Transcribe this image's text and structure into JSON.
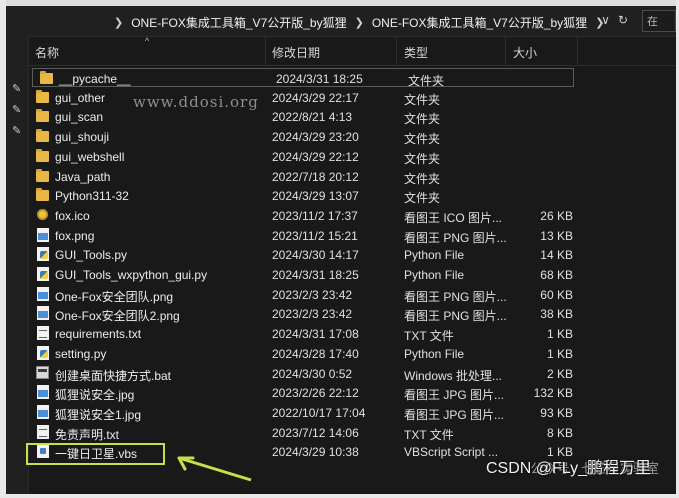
{
  "address": {
    "crumbs": [
      "ONE-FOX集成工具箱_V7公开版_by狐狸",
      "ONE-FOX集成工具箱_V7公开版_by狐狸"
    ],
    "search_placeholder": "在"
  },
  "headers": {
    "name": "名称",
    "date": "修改日期",
    "type": "类型",
    "size": "大小"
  },
  "files": [
    {
      "name": "__pycache__",
      "date": "2024/3/31 18:25",
      "type": "文件夹",
      "size": "",
      "icon": "folder-icon",
      "kind": "folder"
    },
    {
      "name": "gui_other",
      "date": "2024/3/29 22:17",
      "type": "文件夹",
      "size": "",
      "icon": "folder-icon",
      "kind": "folder"
    },
    {
      "name": "gui_scan",
      "date": "2022/8/21 4:13",
      "type": "文件夹",
      "size": "",
      "icon": "folder-icon",
      "kind": "folder"
    },
    {
      "name": "gui_shouji",
      "date": "2024/3/29 23:20",
      "type": "文件夹",
      "size": "",
      "icon": "folder-icon",
      "kind": "folder"
    },
    {
      "name": "gui_webshell",
      "date": "2024/3/29 22:12",
      "type": "文件夹",
      "size": "",
      "icon": "folder-icon",
      "kind": "folder"
    },
    {
      "name": "Java_path",
      "date": "2022/7/18 20:12",
      "type": "文件夹",
      "size": "",
      "icon": "folder-icon",
      "kind": "folder"
    },
    {
      "name": "Python311-32",
      "date": "2024/3/29 13:07",
      "type": "文件夹",
      "size": "",
      "icon": "folder-icon",
      "kind": "folder"
    },
    {
      "name": "fox.ico",
      "date": "2023/11/2 17:37",
      "type": "看图王 ICO 图片...",
      "size": "26 KB",
      "icon": "ico-file-icon",
      "kind": "ico"
    },
    {
      "name": "fox.png",
      "date": "2023/11/2 15:21",
      "type": "看图王 PNG 图片...",
      "size": "13 KB",
      "icon": "image-file-icon",
      "kind": "img"
    },
    {
      "name": "GUI_Tools.py",
      "date": "2024/3/30 14:17",
      "type": "Python File",
      "size": "14 KB",
      "icon": "python-file-icon",
      "kind": "py"
    },
    {
      "name": "GUI_Tools_wxpython_gui.py",
      "date": "2024/3/31 18:25",
      "type": "Python File",
      "size": "68 KB",
      "icon": "python-file-icon",
      "kind": "py"
    },
    {
      "name": "One-Fox安全团队.png",
      "date": "2023/2/3 23:42",
      "type": "看图王 PNG 图片...",
      "size": "60 KB",
      "icon": "image-file-icon",
      "kind": "img"
    },
    {
      "name": "One-Fox安全团队2.png",
      "date": "2023/2/3 23:42",
      "type": "看图王 PNG 图片...",
      "size": "38 KB",
      "icon": "image-file-icon",
      "kind": "img"
    },
    {
      "name": "requirements.txt",
      "date": "2024/3/31 17:08",
      "type": "TXT 文件",
      "size": "1 KB",
      "icon": "text-file-icon",
      "kind": "txt"
    },
    {
      "name": "setting.py",
      "date": "2024/3/28 17:40",
      "type": "Python File",
      "size": "1 KB",
      "icon": "python-file-icon",
      "kind": "py"
    },
    {
      "name": "创建桌面快捷方式.bat",
      "date": "2024/3/30 0:52",
      "type": "Windows 批处理...",
      "size": "2 KB",
      "icon": "batch-file-icon",
      "kind": "bat"
    },
    {
      "name": "狐狸说安全.jpg",
      "date": "2023/2/26 22:12",
      "type": "看图王 JPG 图片...",
      "size": "132 KB",
      "icon": "image-file-icon",
      "kind": "img"
    },
    {
      "name": "狐狸说安全1.jpg",
      "date": "2022/10/17 17:04",
      "type": "看图王 JPG 图片...",
      "size": "93 KB",
      "icon": "image-file-icon",
      "kind": "img"
    },
    {
      "name": "免责声明.txt",
      "date": "2023/7/12 14:06",
      "type": "TXT 文件",
      "size": "8 KB",
      "icon": "text-file-icon",
      "kind": "txt"
    },
    {
      "name": "一键日卫星.vbs",
      "date": "2024/3/29 10:38",
      "type": "VBScript Script ...",
      "size": "1 KB",
      "icon": "vbs-file-icon",
      "kind": "vbs"
    }
  ],
  "overlays": {
    "watermark": "www.ddosi.org",
    "footer_faded": "公众号 · 七芒星实验室",
    "footer": "CSDN @FLy_鹏程万里"
  },
  "colors": {
    "highlight": "#c7e04a",
    "folder": "#e7b845",
    "background": "#191919"
  }
}
